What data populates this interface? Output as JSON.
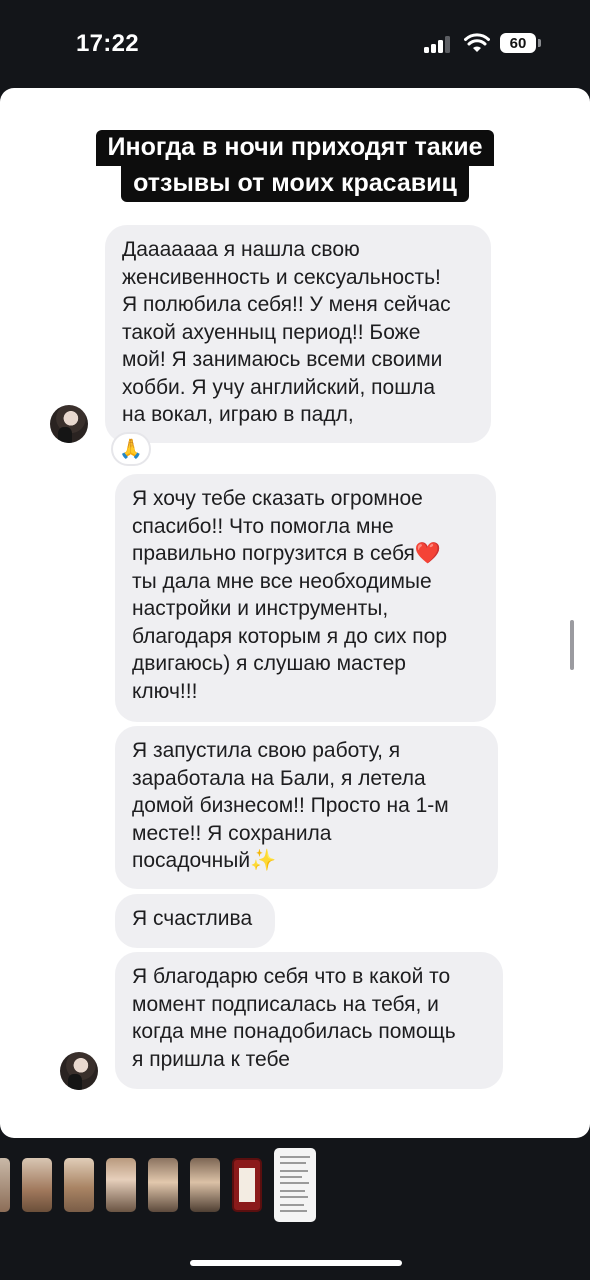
{
  "status_bar": {
    "time": "17:22",
    "battery_level": "60"
  },
  "story": {
    "headline_line1": "Иногда в ночи приходят такие",
    "headline_line2": "отзывы от моих красавиц",
    "messages": [
      "Дааааааа я нашла свою\nженсивенность и сексуальность!\nЯ полюбила себя!! У меня сейчас\nтакой ахуенныц период!! Боже\nмой! Я занимаюсь всеми своими\nхобби. Я учу английский, пошла\nна вокал, играю в падл,",
      "Я хочу тебе сказать огромное\nспасибо!! Что помогла мне\nправильно погрузится в себя❤️\nты дала мне все необходимые\nнастройки и инструменты,\nблагодаря которым я до сих пор\nдвигаюсь) я слушаю мастер\nключ!!!",
      "Я запустила свою работу, я\nзаработала на Бали, я летела\nдомой бизнесом!! Просто на 1-м\nместе!! Я сохранила\nпосадочный✨",
      "Я счастлива",
      "Я благодарю себя что в какой то\nмомент подписалась на тебя, и\nкогда мне понадобилась помощь\nя пришла к тебе"
    ],
    "reaction_emoji": "🙏"
  },
  "icons": {
    "signal": "cellular-signal-icon",
    "wifi": "wifi-icon",
    "battery": "battery-icon"
  },
  "thumbnails_count": 8,
  "colors": {
    "background": "#131519",
    "bubble": "#efeff2",
    "headline_bg": "#0d0d0d"
  }
}
